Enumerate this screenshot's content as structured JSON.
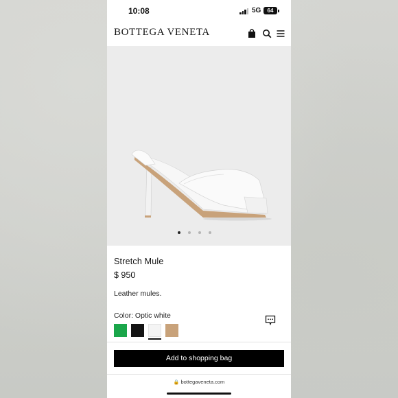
{
  "status_bar": {
    "time": "10:08",
    "network": "5G",
    "battery": "64"
  },
  "header": {
    "brand": "BOTTEGA VENETA",
    "icons": [
      "shopping-bag-icon",
      "search-icon",
      "menu-icon"
    ]
  },
  "gallery": {
    "image": "white-stretch-mule-heel",
    "total_slides": 4,
    "active_slide": 1
  },
  "product": {
    "name": "Stretch Mule",
    "price": "$ 950",
    "description": "Leather mules.",
    "color_label": "Color: Optic white",
    "swatches": [
      {
        "name": "green",
        "hex": "#1aa64a"
      },
      {
        "name": "black",
        "hex": "#141414"
      },
      {
        "name": "optic-white",
        "hex": "#f4f4f4",
        "selected": true
      },
      {
        "name": "tan",
        "hex": "#c8a27a"
      }
    ]
  },
  "actions": {
    "add_to_bag": "Add to shopping bag"
  },
  "browser": {
    "url": "bottegaveneta.com"
  }
}
